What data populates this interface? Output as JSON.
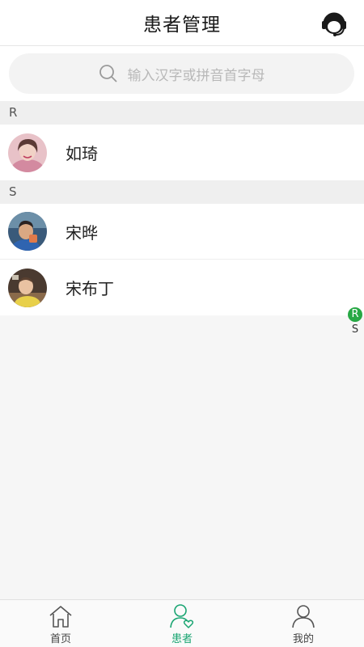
{
  "header": {
    "title": "患者管理",
    "support_icon": "headset-icon"
  },
  "search": {
    "placeholder": "输入汉字或拼音首字母",
    "icon": "search-icon"
  },
  "sections": [
    {
      "letter": "R",
      "patients": [
        {
          "name": "如琦"
        }
      ]
    },
    {
      "letter": "S",
      "patients": [
        {
          "name": "宋晔"
        },
        {
          "name": "宋布丁"
        }
      ]
    }
  ],
  "index_bar": [
    "R",
    "S"
  ],
  "tabs": [
    {
      "label": "首页",
      "icon": "home-icon",
      "active": false
    },
    {
      "label": "患者",
      "icon": "patient-icon",
      "active": true
    },
    {
      "label": "我的",
      "icon": "profile-icon",
      "active": false
    }
  ],
  "colors": {
    "accent": "#1aa572",
    "index_active": "#27a844"
  }
}
